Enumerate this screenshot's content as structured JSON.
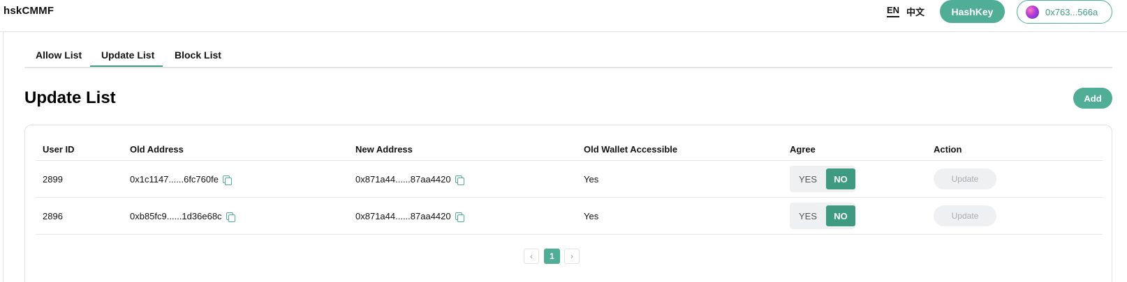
{
  "header": {
    "brand": "hskCMMF",
    "lang_en": "EN",
    "lang_zh": "中文",
    "network_button": "HashKey",
    "wallet_address": "0x763...566a"
  },
  "tabs": [
    {
      "label": "Allow List"
    },
    {
      "label": "Update List",
      "active": true
    },
    {
      "label": "Block List"
    }
  ],
  "page": {
    "title": "Update List",
    "add_button": "Add"
  },
  "table": {
    "columns": [
      "User ID",
      "Old Address",
      "New Address",
      "Old Wallet Accessible",
      "Agree",
      "Action"
    ],
    "rows": [
      {
        "user_id": "2899",
        "old_address": "0x1c1147......6fc760fe",
        "new_address": "0x871a44......87aa4420",
        "accessible": "Yes",
        "agree_yes": "YES",
        "agree_no": "NO",
        "agree_selected": "NO",
        "action": "Update"
      },
      {
        "user_id": "2896",
        "old_address": "0xb85fc9......1d36e68c",
        "new_address": "0x871a44......87aa4420",
        "accessible": "Yes",
        "agree_yes": "YES",
        "agree_no": "NO",
        "agree_selected": "NO",
        "action": "Update"
      }
    ]
  },
  "pagination": {
    "prev": "‹",
    "current": "1",
    "next": "›"
  },
  "colors": {
    "accent": "#4fae95",
    "accent_dark": "#3e9b82"
  }
}
